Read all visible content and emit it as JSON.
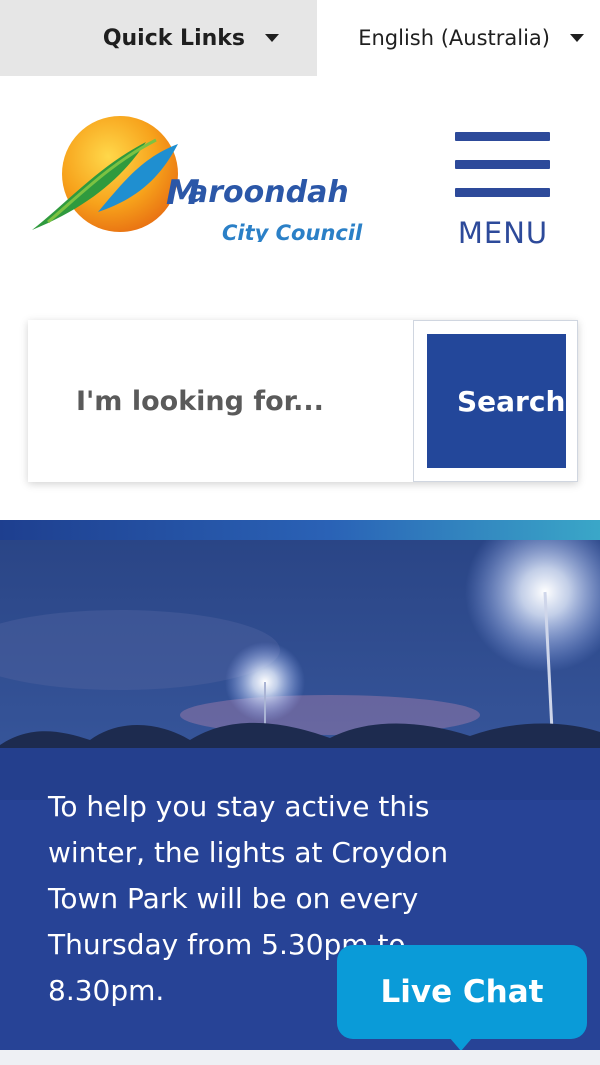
{
  "topbar": {
    "quick_links": "Quick Links",
    "language": "English (Australia)"
  },
  "logo": {
    "name_initial": "M",
    "name_rest": "aroondah",
    "subtitle": "City Council"
  },
  "menu": {
    "label": "MENU"
  },
  "search": {
    "placeholder": "I'm looking for...",
    "button": "Search"
  },
  "hero": {
    "caption": "To help you stay active this winter, the lights at Croydon Town Park will be on every Thursday from 5.30pm to 8.30pm."
  },
  "live_chat": {
    "label": "Live Chat"
  },
  "colors": {
    "brand_blue": "#23479a",
    "chat_blue": "#0a9bd8",
    "logo_orange": "#f5a623",
    "logo_green": "#2f9a3e"
  }
}
